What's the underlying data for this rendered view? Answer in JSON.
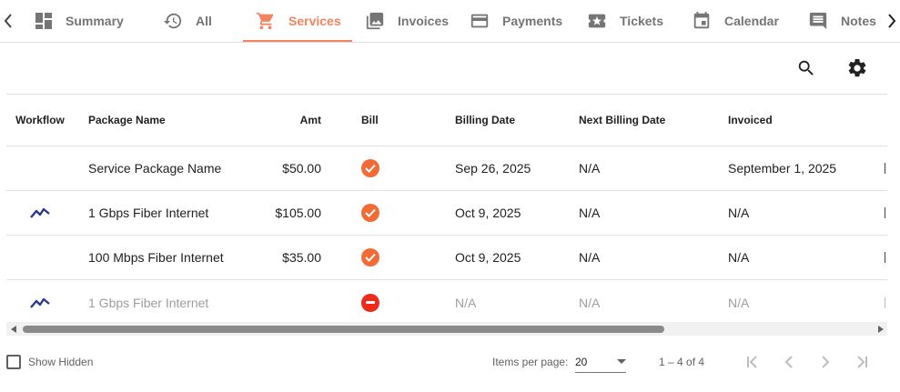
{
  "tabs": [
    {
      "id": "summary",
      "label": "Summary",
      "icon": "dashboard-icon"
    },
    {
      "id": "all",
      "label": "All",
      "icon": "history-icon"
    },
    {
      "id": "services",
      "label": "Services",
      "icon": "cart-icon",
      "active": true
    },
    {
      "id": "invoices",
      "label": "Invoices",
      "icon": "photo-library-icon"
    },
    {
      "id": "payments",
      "label": "Payments",
      "icon": "credit-card-icon"
    },
    {
      "id": "tickets",
      "label": "Tickets",
      "icon": "ticket-icon"
    },
    {
      "id": "calendar",
      "label": "Calendar",
      "icon": "calendar-icon"
    },
    {
      "id": "notes",
      "label": "Notes",
      "icon": "comment-icon"
    }
  ],
  "toolbar": {
    "search_icon": "search-icon",
    "settings_icon": "gear-icon"
  },
  "table": {
    "columns": {
      "workflow": "Workflow",
      "package": "Package Name",
      "amt": "Amt",
      "bill": "Bill",
      "billing_date": "Billing Date",
      "next_billing_date": "Next Billing Date",
      "invoiced": "Invoiced"
    },
    "rows": [
      {
        "workflow": false,
        "package": "Service Package Name",
        "amt": "$50.00",
        "bill": "checked",
        "billing_date": "Sep 26, 2025",
        "next_billing_date": "N/A",
        "invoiced": "September 1, 2025",
        "muted": false
      },
      {
        "workflow": true,
        "package": "1 Gbps Fiber Internet",
        "amt": "$105.00",
        "bill": "checked",
        "billing_date": "Oct 9, 2025",
        "next_billing_date": "N/A",
        "invoiced": "N/A",
        "muted": false
      },
      {
        "workflow": false,
        "package": "100 Mbps Fiber Internet",
        "amt": "$35.00",
        "bill": "checked",
        "billing_date": "Oct 9, 2025",
        "next_billing_date": "N/A",
        "invoiced": "N/A",
        "muted": false
      },
      {
        "workflow": true,
        "package": "1 Gbps Fiber Internet",
        "amt": "",
        "bill": "blocked",
        "billing_date": "N/A",
        "next_billing_date": "N/A",
        "invoiced": "N/A",
        "muted": true
      }
    ]
  },
  "footer": {
    "show_hidden_label": "Show Hidden",
    "items_per_page_label": "Items per page:",
    "items_per_page_value": "20",
    "range_label": "1 – 4 of 4"
  },
  "colors": {
    "accent": "#f4845f",
    "bill_ok": "#f26a36",
    "bill_blocked": "#f02a1a",
    "workflow_icon": "#2b3a8f"
  }
}
